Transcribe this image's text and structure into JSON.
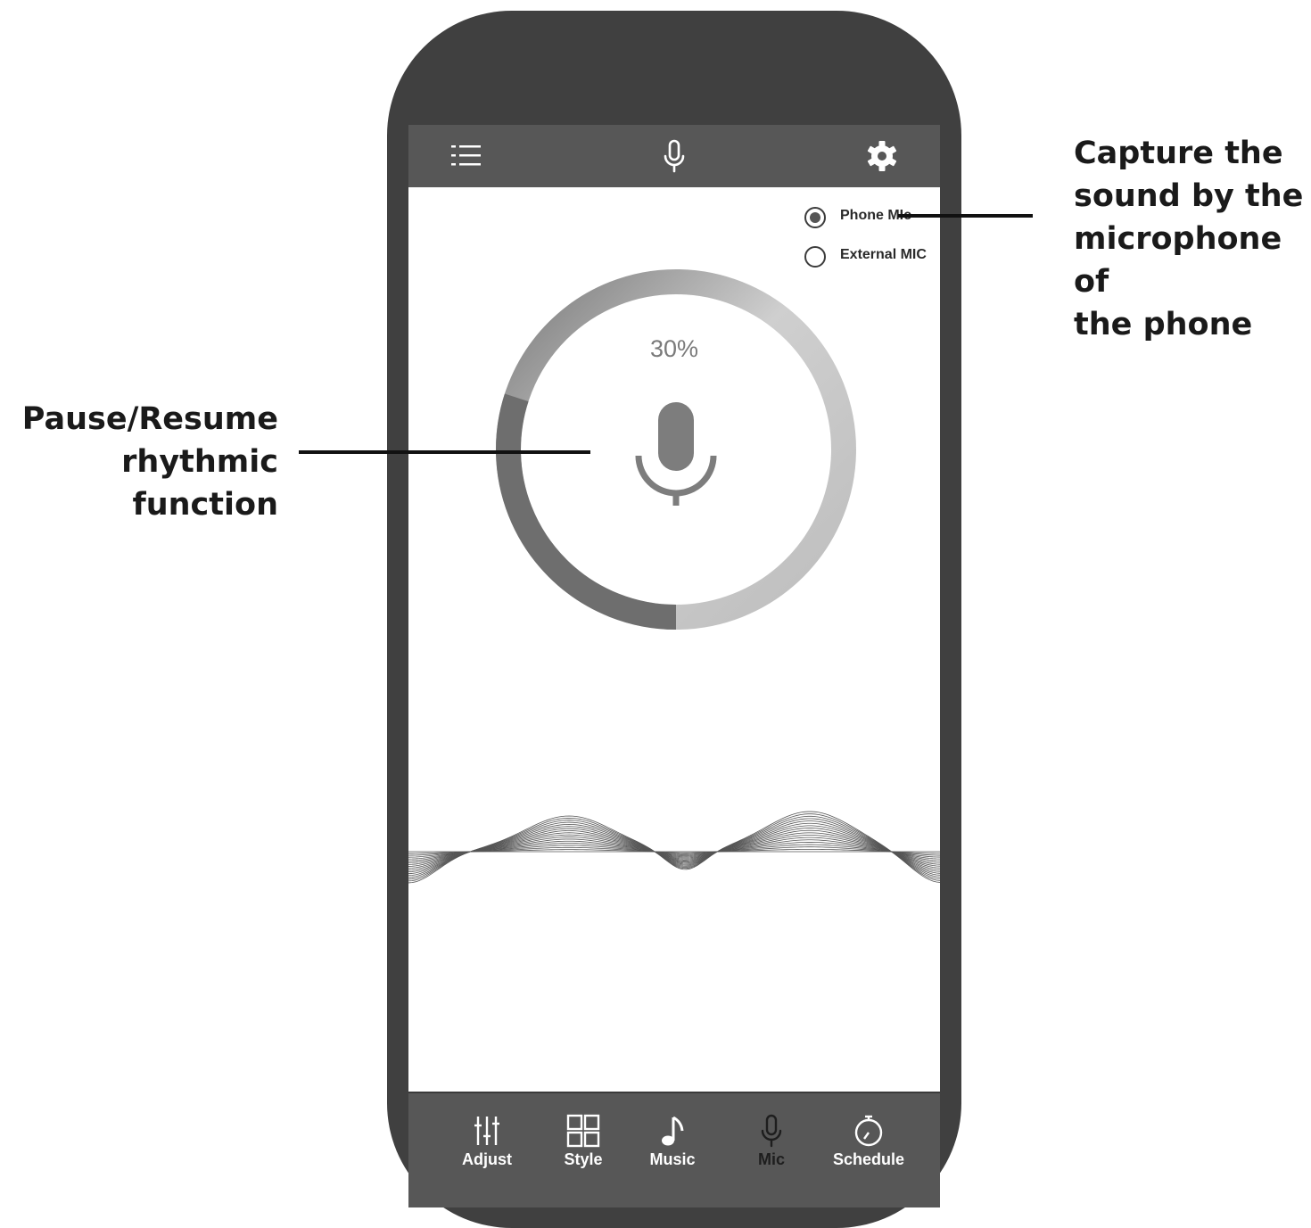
{
  "header": {
    "menu_icon": "list-icon",
    "center_icon": "microphone-icon",
    "settings_icon": "gear-icon"
  },
  "mic_source": {
    "options": [
      {
        "label": "Phone MIc",
        "selected": true
      },
      {
        "label": "External MIC",
        "selected": false
      }
    ]
  },
  "sensitivity": {
    "value_label": "30%",
    "level": 0.3,
    "button_icon": "microphone-icon"
  },
  "bottom_nav": {
    "items": [
      {
        "label": "Adjust",
        "icon": "sliders-icon",
        "active": false
      },
      {
        "label": "Style",
        "icon": "grid-icon",
        "active": false
      },
      {
        "label": "Music",
        "icon": "music-note-icon",
        "active": false
      },
      {
        "label": "Mic",
        "icon": "microphone-icon",
        "active": true
      },
      {
        "label": "Schedule",
        "icon": "timer-icon",
        "active": false
      }
    ]
  },
  "annotations": {
    "right_lines": [
      "Capture the",
      "sound by the",
      "microphone of",
      "the phone"
    ],
    "left_lines": [
      "Pause/Resume",
      "rhythmic function"
    ]
  },
  "colors": {
    "phone_body": "#404040",
    "bars": "#575757",
    "ring_dark": "#6e6e6e",
    "ring_light": "#bdbdbd"
  }
}
